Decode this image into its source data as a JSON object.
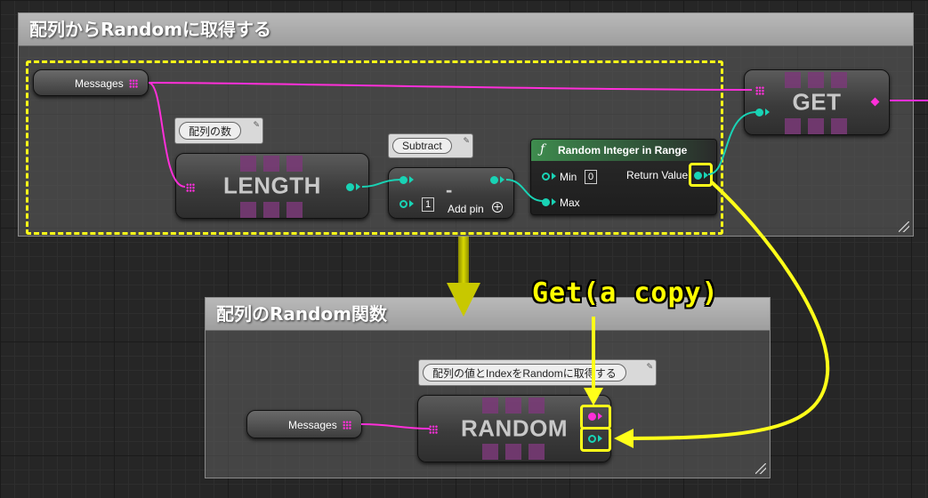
{
  "top_comment": {
    "title": "配列からRandomに取得する"
  },
  "bottom_comment": {
    "title": "配列のRandom関数"
  },
  "messages_var_top": {
    "label": "Messages"
  },
  "messages_var_bottom": {
    "label": "Messages"
  },
  "length_node": {
    "label": "LENGTH",
    "comment": "配列の数"
  },
  "subtract_node": {
    "label": "-",
    "comment": "Subtract",
    "input_value": "1",
    "add_pin_label": "Add pin"
  },
  "random_int_node": {
    "title": "Random Integer in Range",
    "min_label": "Min",
    "min_value": "0",
    "max_label": "Max",
    "return_label": "Return Value"
  },
  "get_node": {
    "label": "GET"
  },
  "random_node": {
    "label": "RANDOM",
    "comment": "配列の値とIndexをRandomに取得する"
  },
  "annotation": {
    "text": "Get(a copy)"
  },
  "colors": {
    "array_pin": "#ff2fd9",
    "int_pin": "#19d3b5",
    "highlight": "#ffff19"
  }
}
